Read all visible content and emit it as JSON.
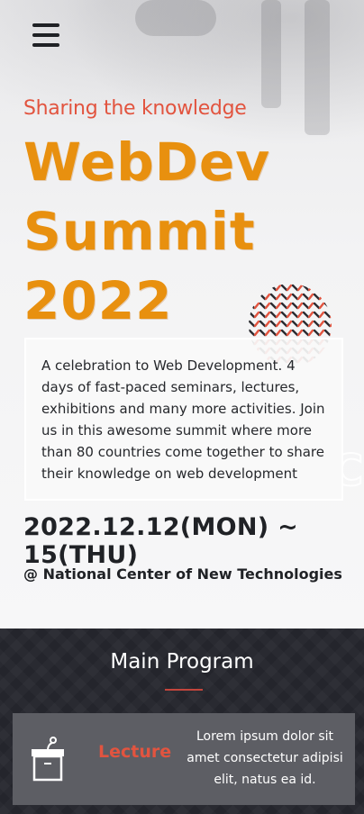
{
  "header": {
    "menu_icon": "hamburger-menu-icon"
  },
  "hero": {
    "tagline": "Sharing the knowledge",
    "title_lines": [
      "WebDev",
      "Summit",
      "2022"
    ],
    "description": "A celebration to Web Development. 4 days of fast-paced seminars, lectures, exhibitions and many more activities. Join us in this awesome summit where more than 80 countries come together to share their knowledge on web development",
    "dates": "2022.12.12(MON) ~ 15(THU)",
    "venue": "@ National Center of New Technologies",
    "decor_letter": "C",
    "decor_mark": "×"
  },
  "program": {
    "title": "Main Program",
    "cards": [
      {
        "icon": "podium-lecture-icon",
        "label": "Lecture",
        "text": "Lorem ipsum dolor sit amet consectetur adipisi elit, natus ea id."
      }
    ]
  },
  "colors": {
    "accent_red": "#e2543f",
    "title_orange": "#e8900f",
    "dark_bg": "#24252c",
    "card_bg": "#5d5e64"
  }
}
